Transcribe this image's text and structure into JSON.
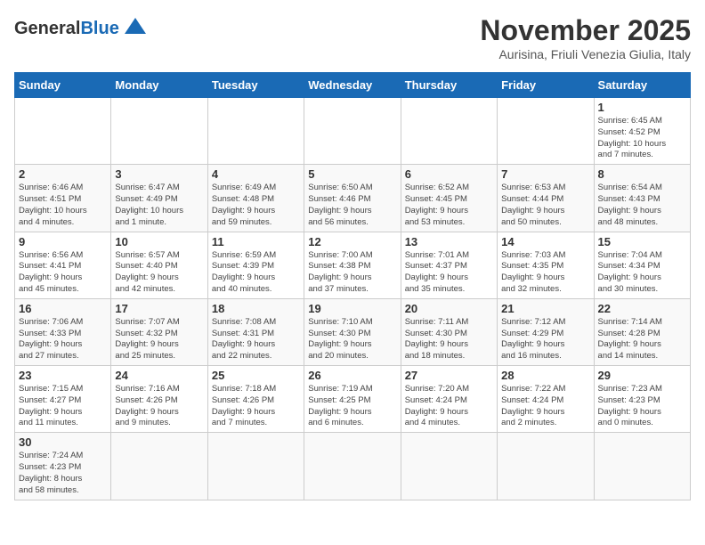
{
  "header": {
    "logo_general": "General",
    "logo_blue": "Blue",
    "month_title": "November 2025",
    "subtitle": "Aurisina, Friuli Venezia Giulia, Italy"
  },
  "weekdays": [
    "Sunday",
    "Monday",
    "Tuesday",
    "Wednesday",
    "Thursday",
    "Friday",
    "Saturday"
  ],
  "weeks": [
    [
      {
        "day": "",
        "info": ""
      },
      {
        "day": "",
        "info": ""
      },
      {
        "day": "",
        "info": ""
      },
      {
        "day": "",
        "info": ""
      },
      {
        "day": "",
        "info": ""
      },
      {
        "day": "",
        "info": ""
      },
      {
        "day": "1",
        "info": "Sunrise: 6:45 AM\nSunset: 4:52 PM\nDaylight: 10 hours\nand 7 minutes."
      }
    ],
    [
      {
        "day": "2",
        "info": "Sunrise: 6:46 AM\nSunset: 4:51 PM\nDaylight: 10 hours\nand 4 minutes."
      },
      {
        "day": "3",
        "info": "Sunrise: 6:47 AM\nSunset: 4:49 PM\nDaylight: 10 hours\nand 1 minute."
      },
      {
        "day": "4",
        "info": "Sunrise: 6:49 AM\nSunset: 4:48 PM\nDaylight: 9 hours\nand 59 minutes."
      },
      {
        "day": "5",
        "info": "Sunrise: 6:50 AM\nSunset: 4:46 PM\nDaylight: 9 hours\nand 56 minutes."
      },
      {
        "day": "6",
        "info": "Sunrise: 6:52 AM\nSunset: 4:45 PM\nDaylight: 9 hours\nand 53 minutes."
      },
      {
        "day": "7",
        "info": "Sunrise: 6:53 AM\nSunset: 4:44 PM\nDaylight: 9 hours\nand 50 minutes."
      },
      {
        "day": "8",
        "info": "Sunrise: 6:54 AM\nSunset: 4:43 PM\nDaylight: 9 hours\nand 48 minutes."
      }
    ],
    [
      {
        "day": "9",
        "info": "Sunrise: 6:56 AM\nSunset: 4:41 PM\nDaylight: 9 hours\nand 45 minutes."
      },
      {
        "day": "10",
        "info": "Sunrise: 6:57 AM\nSunset: 4:40 PM\nDaylight: 9 hours\nand 42 minutes."
      },
      {
        "day": "11",
        "info": "Sunrise: 6:59 AM\nSunset: 4:39 PM\nDaylight: 9 hours\nand 40 minutes."
      },
      {
        "day": "12",
        "info": "Sunrise: 7:00 AM\nSunset: 4:38 PM\nDaylight: 9 hours\nand 37 minutes."
      },
      {
        "day": "13",
        "info": "Sunrise: 7:01 AM\nSunset: 4:37 PM\nDaylight: 9 hours\nand 35 minutes."
      },
      {
        "day": "14",
        "info": "Sunrise: 7:03 AM\nSunset: 4:35 PM\nDaylight: 9 hours\nand 32 minutes."
      },
      {
        "day": "15",
        "info": "Sunrise: 7:04 AM\nSunset: 4:34 PM\nDaylight: 9 hours\nand 30 minutes."
      }
    ],
    [
      {
        "day": "16",
        "info": "Sunrise: 7:06 AM\nSunset: 4:33 PM\nDaylight: 9 hours\nand 27 minutes."
      },
      {
        "day": "17",
        "info": "Sunrise: 7:07 AM\nSunset: 4:32 PM\nDaylight: 9 hours\nand 25 minutes."
      },
      {
        "day": "18",
        "info": "Sunrise: 7:08 AM\nSunset: 4:31 PM\nDaylight: 9 hours\nand 22 minutes."
      },
      {
        "day": "19",
        "info": "Sunrise: 7:10 AM\nSunset: 4:30 PM\nDaylight: 9 hours\nand 20 minutes."
      },
      {
        "day": "20",
        "info": "Sunrise: 7:11 AM\nSunset: 4:30 PM\nDaylight: 9 hours\nand 18 minutes."
      },
      {
        "day": "21",
        "info": "Sunrise: 7:12 AM\nSunset: 4:29 PM\nDaylight: 9 hours\nand 16 minutes."
      },
      {
        "day": "22",
        "info": "Sunrise: 7:14 AM\nSunset: 4:28 PM\nDaylight: 9 hours\nand 14 minutes."
      }
    ],
    [
      {
        "day": "23",
        "info": "Sunrise: 7:15 AM\nSunset: 4:27 PM\nDaylight: 9 hours\nand 11 minutes."
      },
      {
        "day": "24",
        "info": "Sunrise: 7:16 AM\nSunset: 4:26 PM\nDaylight: 9 hours\nand 9 minutes."
      },
      {
        "day": "25",
        "info": "Sunrise: 7:18 AM\nSunset: 4:26 PM\nDaylight: 9 hours\nand 7 minutes."
      },
      {
        "day": "26",
        "info": "Sunrise: 7:19 AM\nSunset: 4:25 PM\nDaylight: 9 hours\nand 6 minutes."
      },
      {
        "day": "27",
        "info": "Sunrise: 7:20 AM\nSunset: 4:24 PM\nDaylight: 9 hours\nand 4 minutes."
      },
      {
        "day": "28",
        "info": "Sunrise: 7:22 AM\nSunset: 4:24 PM\nDaylight: 9 hours\nand 2 minutes."
      },
      {
        "day": "29",
        "info": "Sunrise: 7:23 AM\nSunset: 4:23 PM\nDaylight: 9 hours\nand 0 minutes."
      }
    ],
    [
      {
        "day": "30",
        "info": "Sunrise: 7:24 AM\nSunset: 4:23 PM\nDaylight: 8 hours\nand 58 minutes."
      },
      {
        "day": "",
        "info": ""
      },
      {
        "day": "",
        "info": ""
      },
      {
        "day": "",
        "info": ""
      },
      {
        "day": "",
        "info": ""
      },
      {
        "day": "",
        "info": ""
      },
      {
        "day": "",
        "info": ""
      }
    ]
  ]
}
